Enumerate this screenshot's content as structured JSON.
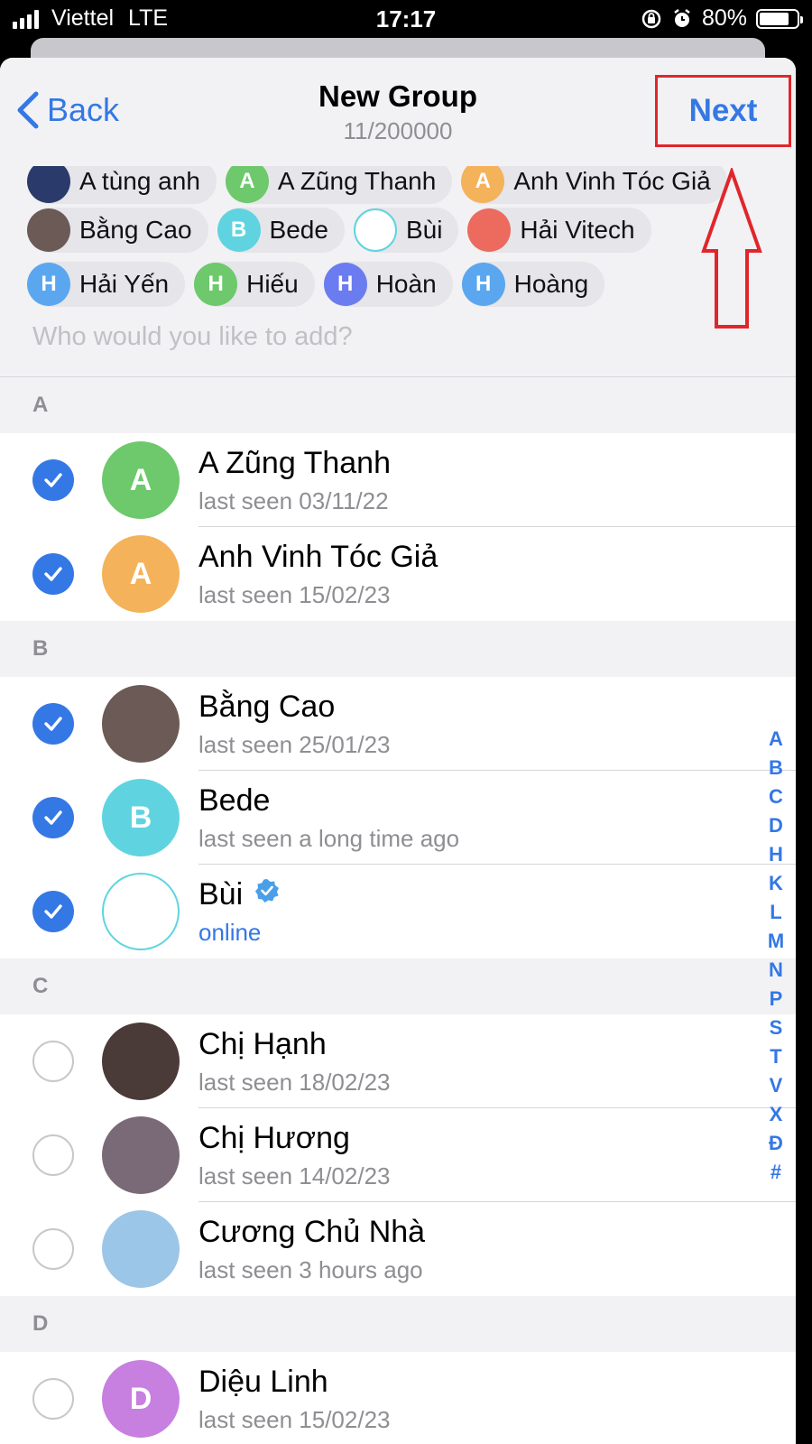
{
  "status_bar": {
    "carrier": "Viettel",
    "network": "LTE",
    "time": "17:17",
    "battery": "80%",
    "battery_level": 0.8
  },
  "nav": {
    "back_label": "Back",
    "title": "New Group",
    "subtitle": "11/200000",
    "next_label": "Next"
  },
  "chips": [
    [
      {
        "label": "A tùng anh",
        "initial": "",
        "color": "#2a3a6b"
      },
      {
        "label": "A Zũng Thanh",
        "initial": "A",
        "color": "#6dc96b"
      },
      {
        "label": "Anh Vinh Tóc Giả",
        "initial": "A",
        "color": "#f4b25a"
      }
    ],
    [
      {
        "label": "Bằng Cao",
        "initial": "",
        "color": "#6b5a55"
      },
      {
        "label": "Bede",
        "initial": "B",
        "color": "#5fd4e0"
      },
      {
        "label": "Bùi",
        "initial": "",
        "color": "#ffffff"
      },
      {
        "label": "Hải Vitech",
        "initial": "",
        "color": "#ec6a5e"
      }
    ],
    [
      {
        "label": "Hải Yến",
        "initial": "H",
        "color": "#5aa7ef"
      },
      {
        "label": "Hiếu",
        "initial": "H",
        "color": "#6dc96b"
      },
      {
        "label": "Hoàn",
        "initial": "H",
        "color": "#6b7cf0"
      },
      {
        "label": "Hoàng",
        "initial": "H",
        "color": "#5aa7ef"
      }
    ]
  ],
  "search": {
    "placeholder": "Who would you like to add?"
  },
  "sections": [
    {
      "letter": "A",
      "contacts": [
        {
          "name": "A Zũng Thanh",
          "status": "last seen 03/11/22",
          "selected": true,
          "initial": "A",
          "color": "#6dc96b"
        },
        {
          "name": "Anh Vinh Tóc Giả",
          "status": "last seen 15/02/23",
          "selected": true,
          "initial": "A",
          "color": "#f4b25a"
        }
      ]
    },
    {
      "letter": "B",
      "contacts": [
        {
          "name": "Bằng Cao",
          "status": "last seen 25/01/23",
          "selected": true,
          "initial": "",
          "color": "#6b5a55"
        },
        {
          "name": "Bede",
          "status": "last seen a long time ago",
          "selected": true,
          "initial": "B",
          "color": "#5fd4e0"
        },
        {
          "name": "Bùi",
          "status": "online",
          "selected": true,
          "initial": "",
          "color": "#ffffff",
          "verified": true,
          "online": true
        }
      ]
    },
    {
      "letter": "C",
      "contacts": [
        {
          "name": "Chị Hạnh",
          "status": "last seen 18/02/23",
          "selected": false,
          "initial": "",
          "color": "#4a3a38"
        },
        {
          "name": "Chị Hương",
          "status": "last seen 14/02/23",
          "selected": false,
          "initial": "",
          "color": "#7a6a78"
        },
        {
          "name": "Cương Chủ Nhà",
          "status": "last seen 3 hours ago",
          "selected": false,
          "initial": "",
          "color": "#9cc6e8"
        }
      ]
    },
    {
      "letter": "D",
      "contacts": [
        {
          "name": "Diệu Linh",
          "status": "last seen 15/02/23",
          "selected": false,
          "initial": "D",
          "color": "#c77fe0"
        }
      ]
    }
  ],
  "index_letters": [
    "A",
    "B",
    "C",
    "D",
    "H",
    "K",
    "L",
    "M",
    "N",
    "P",
    "S",
    "T",
    "V",
    "X",
    "Đ",
    "#"
  ],
  "colors": {
    "accent": "#3478e5",
    "highlight": "#e0262b"
  }
}
